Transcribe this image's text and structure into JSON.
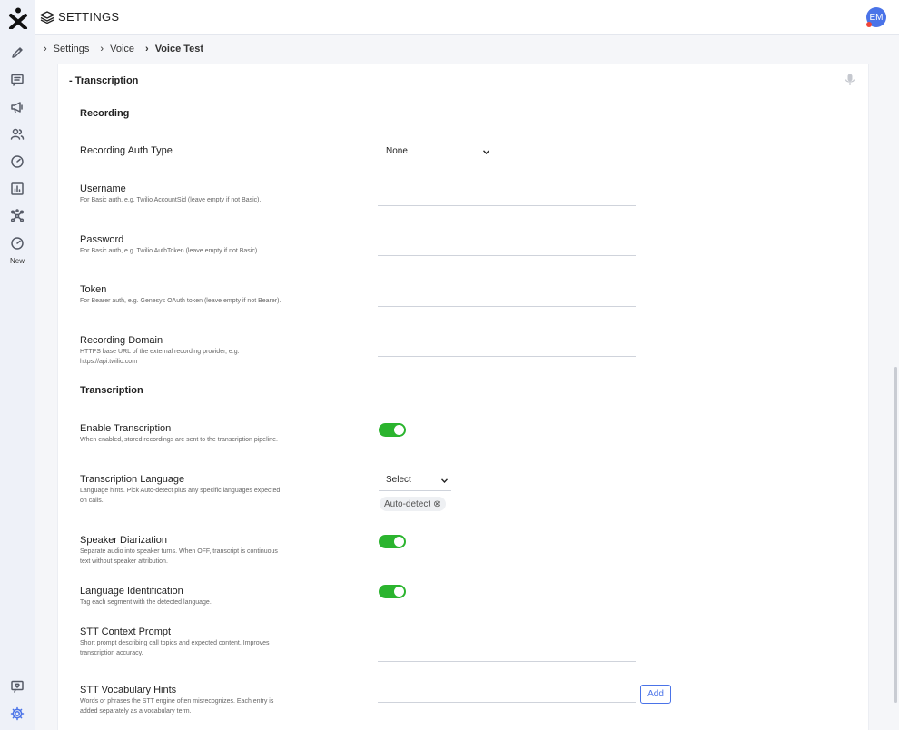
{
  "app": {
    "title": "SETTINGS",
    "avatar_initials": "EM"
  },
  "rail": {
    "new_label": "New"
  },
  "breadcrumb": [
    "Settings",
    "Voice",
    "Voice Test"
  ],
  "section": {
    "title": "- Transcription"
  },
  "recording": {
    "title": "Recording",
    "auth_type_label": "Recording Auth Type",
    "auth_type_value": "None",
    "username_label": "Username",
    "username_desc": "For Basic auth, e.g. Twilio AccountSid (leave empty if not Basic).",
    "password_label": "Password",
    "password_desc": "For Basic auth, e.g. Twilio AuthToken (leave empty if not Basic).",
    "token_label": "Token",
    "token_desc": "For Bearer auth, e.g. Genesys OAuth token (leave empty if not Bearer).",
    "domain_label": "Recording Domain",
    "domain_desc": "HTTPS base URL of the external recording provider, e.g. https://api.twilio.com"
  },
  "transcription": {
    "title": "Transcription",
    "enable_label": "Enable Transcription",
    "enable_desc": "When enabled, stored recordings are sent to the transcription pipeline.",
    "enable_on": true,
    "language_label": "Transcription Language",
    "language_desc": "Language hints. Pick Auto-detect plus any specific languages expected on calls.",
    "language_select": "Select",
    "language_chip": "Auto-detect",
    "diarization_label": "Speaker Diarization",
    "diarization_desc": "Separate audio into speaker turns. When OFF, transcript is continuous text without speaker attribution.",
    "diarization_on": true,
    "langid_label": "Language Identification",
    "langid_desc": "Tag each segment with the detected language.",
    "langid_on": true,
    "context_label": "STT Context Prompt",
    "context_desc": "Short prompt describing call topics and expected content. Improves transcription accuracy.",
    "vocab_label": "STT Vocabulary Hints",
    "vocab_desc": "Words or phrases the STT engine often misrecognizes. Each entry is added separately as a vocabulary term.",
    "add_label": "Add"
  },
  "colors": {
    "accent": "#4a73e8",
    "toggle_on": "#2bb42e",
    "rail_bg": "#eef1f8"
  }
}
